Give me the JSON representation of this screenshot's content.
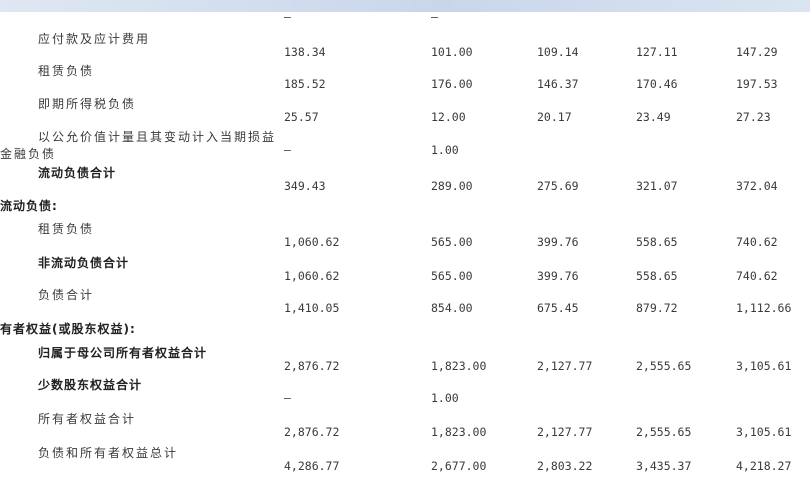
{
  "top_dashes": [
    "–",
    "–"
  ],
  "rows": [
    {
      "label": "应付款及应计费用",
      "indent": 38,
      "bold": false,
      "values": [
        "138.34",
        "101.00",
        "109.14",
        "127.11",
        "147.29"
      ]
    },
    {
      "label": "租赁负债",
      "indent": 38,
      "bold": false,
      "values": [
        "185.52",
        "176.00",
        "146.37",
        "170.46",
        "197.53"
      ]
    },
    {
      "label": "即期所得税负债",
      "indent": 38,
      "bold": false,
      "values": [
        "25.57",
        "12.00",
        "20.17",
        "23.49",
        "27.23"
      ]
    },
    {
      "label": "以公允价值计量且其变动计入当期损益",
      "label2": "金融负债",
      "indent": 38,
      "bold": false,
      "values": [
        "–",
        "1.00",
        "",
        "",
        ""
      ]
    },
    {
      "label": "流动负债合计",
      "indent": 38,
      "bold": true,
      "values": [
        "349.43",
        "289.00",
        "275.69",
        "321.07",
        "372.04"
      ]
    },
    {
      "label": "流动负债:",
      "indent": 0,
      "bold": true,
      "values": [
        "",
        "",
        "",
        "",
        ""
      ]
    },
    {
      "label": "租赁负债",
      "indent": 38,
      "bold": false,
      "values": [
        "1,060.62",
        "565.00",
        "399.76",
        "558.65",
        "740.62"
      ]
    },
    {
      "label": "非流动负债合计",
      "indent": 38,
      "bold": true,
      "values": [
        "1,060.62",
        "565.00",
        "399.76",
        "558.65",
        "740.62"
      ]
    },
    {
      "label": "负债合计",
      "indent": 38,
      "bold": false,
      "values": [
        "1,410.05",
        "854.00",
        "675.45",
        "879.72",
        "1,112.66"
      ]
    },
    {
      "label": "有者权益(或股东权益):",
      "indent": 0,
      "bold": true,
      "values": [
        "",
        "",
        "",
        "",
        ""
      ]
    },
    {
      "label": "归属于母公司所有者权益合计",
      "indent": 38,
      "bold": true,
      "values": [
        "2,876.72",
        "1,823.00",
        "2,127.77",
        "2,555.65",
        "3,105.61"
      ]
    },
    {
      "label": "少数股东权益合计",
      "indent": 38,
      "bold": true,
      "values": [
        "–",
        "1.00",
        "",
        "",
        ""
      ]
    },
    {
      "label": "所有者权益合计",
      "indent": 38,
      "bold": false,
      "values": [
        "2,876.72",
        "1,823.00",
        "2,127.77",
        "2,555.65",
        "3,105.61"
      ]
    },
    {
      "label": "负债和所有者权益总计",
      "indent": 38,
      "bold": false,
      "values": [
        "4,286.77",
        "2,677.00",
        "2,803.22",
        "3,435.37",
        "4,218.27"
      ]
    }
  ]
}
